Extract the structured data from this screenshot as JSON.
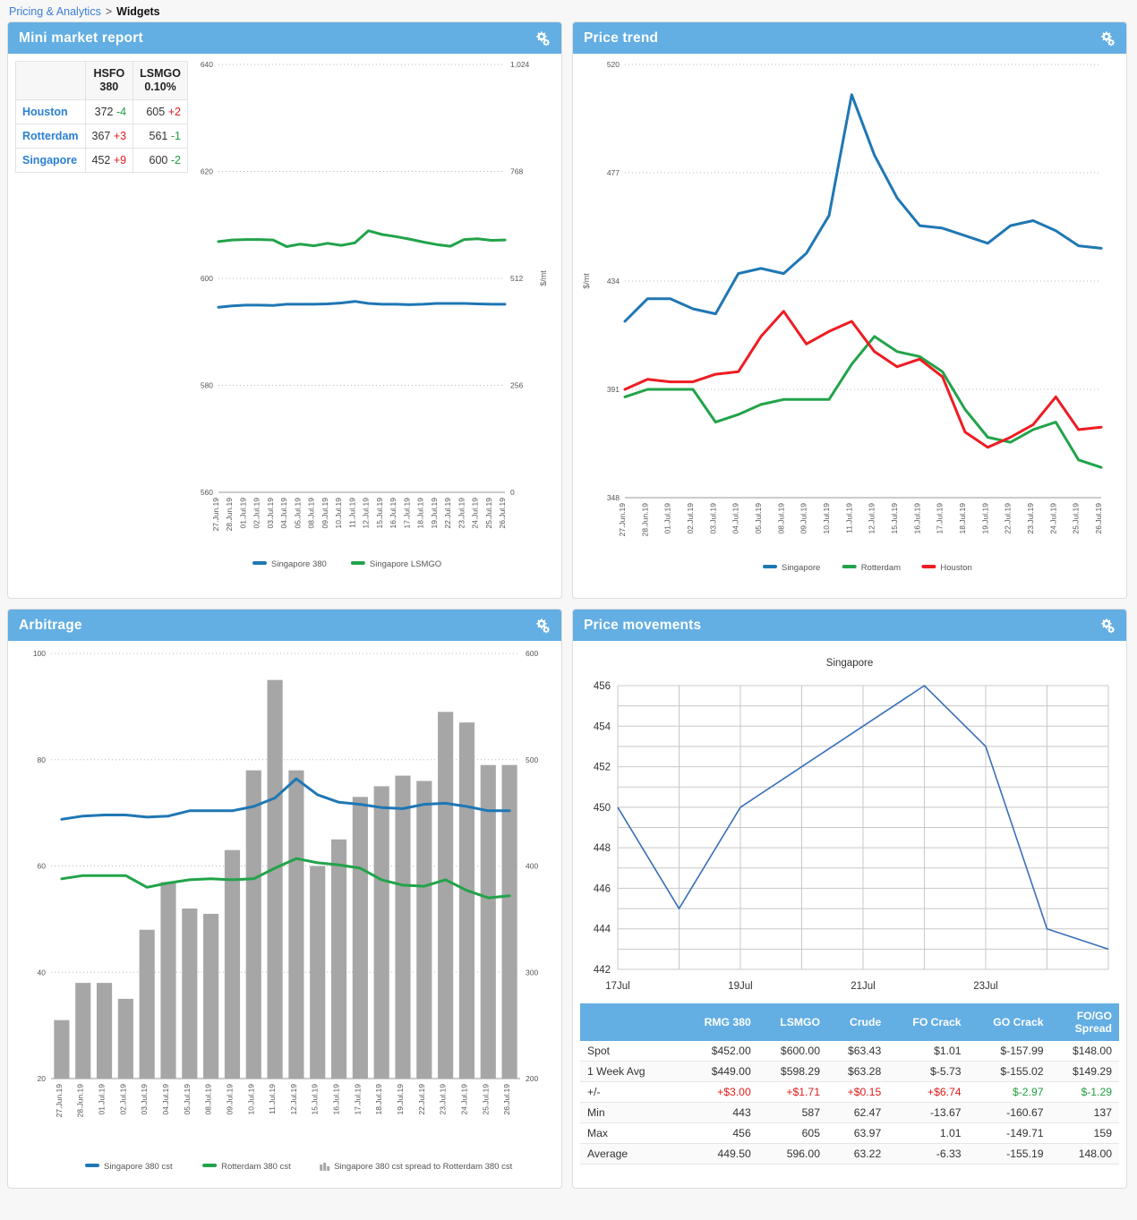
{
  "breadcrumb": {
    "root": "Pricing & Analytics",
    "separator": ">",
    "current": "Widgets"
  },
  "icons": {
    "settings": "cogs-icon"
  },
  "colors": {
    "header": "#63aee3",
    "blue": "#1f77b4",
    "green": "#22a34a",
    "red": "#ee1c23",
    "bar": "#a6a6a6",
    "up": "#e01b1b",
    "down": "#1f9e3f"
  },
  "panels": {
    "mini": {
      "title": "Mini market report"
    },
    "trend": {
      "title": "Price trend"
    },
    "arbitrage": {
      "title": "Arbitrage"
    },
    "movements": {
      "title": "Price movements"
    }
  },
  "mini_table": {
    "columns": [
      "",
      "HSFO 380",
      "LSMGO 0.10%"
    ],
    "col_head_lines": [
      [
        "HSFO",
        "380"
      ],
      [
        "LSMGO",
        "0.10%"
      ]
    ],
    "rows": [
      {
        "location": "Houston",
        "hsfo": "372",
        "hsfo_chg": "-4",
        "hsfo_dir": "down",
        "lsmgo": "605",
        "lsmgo_chg": "+2",
        "lsmgo_dir": "up"
      },
      {
        "location": "Rotterdam",
        "hsfo": "367",
        "hsfo_chg": "+3",
        "hsfo_dir": "up",
        "lsmgo": "561",
        "lsmgo_chg": "-1",
        "lsmgo_dir": "down"
      },
      {
        "location": "Singapore",
        "hsfo": "452",
        "hsfo_chg": "+9",
        "hsfo_dir": "up",
        "lsmgo": "600",
        "lsmgo_chg": "-2",
        "lsmgo_dir": "down"
      }
    ]
  },
  "dates": [
    "27.Jun.19",
    "28.Jun.19",
    "01.Jul.19",
    "02.Jul.19",
    "03.Jul.19",
    "04.Jul.19",
    "05.Jul.19",
    "08.Jul.19",
    "09.Jul.19",
    "10.Jul.19",
    "11.Jul.19",
    "12.Jul.19",
    "15.Jul.19",
    "16.Jul.19",
    "17.Jul.19",
    "18.Jul.19",
    "19.Jul.19",
    "22.Jul.19",
    "23.Jul.19",
    "24.Jul.19",
    "25.Jul.19",
    "26.Jul.19"
  ],
  "chart_data": [
    {
      "id": "mini-market-report",
      "type": "line",
      "title": "Mini market report",
      "ylabel": "$/mt",
      "x": [
        "27.Jun.19",
        "28.Jun.19",
        "01.Jul.19",
        "02.Jul.19",
        "03.Jul.19",
        "04.Jul.19",
        "05.Jul.19",
        "08.Jul.19",
        "09.Jul.19",
        "10.Jul.19",
        "11.Jul.19",
        "12.Jul.19",
        "15.Jul.19",
        "16.Jul.19",
        "17.Jul.19",
        "18.Jul.19",
        "19.Jul.19",
        "22.Jul.19",
        "23.Jul.19",
        "24.Jul.19",
        "25.Jul.19",
        "26.Jul.19"
      ],
      "left_axis": {
        "ticks": [
          560,
          580,
          600,
          620,
          640
        ],
        "min": 560,
        "max": 640
      },
      "right_axis": {
        "ticks": [
          0,
          256,
          512,
          768,
          1024
        ],
        "tick_labels": [
          "0",
          "256",
          "512",
          "768",
          "1,024"
        ],
        "min": 0,
        "max": 1024
      },
      "grid": true,
      "legend_position": "bottom",
      "series": [
        {
          "name": "Singapore 380",
          "color": "#1f77b4",
          "axis": "right",
          "values": [
            443,
            446,
            448,
            448,
            447,
            450,
            450,
            450,
            451,
            453,
            457,
            452,
            450,
            450,
            449,
            450,
            452,
            452,
            452,
            451,
            450,
            450
          ]
        },
        {
          "name": "Singapore LSMGO",
          "color": "#22a34a",
          "axis": "right",
          "values": [
            600,
            604,
            605,
            605,
            604,
            588,
            594,
            590,
            596,
            591,
            597,
            626,
            617,
            612,
            606,
            599,
            593,
            589,
            605,
            607,
            603,
            604
          ]
        }
      ]
    },
    {
      "id": "price-trend",
      "type": "line",
      "title": "Price trend",
      "ylabel": "$/mt",
      "x": [
        "27.Jun.19",
        "28.Jun.19",
        "01.Jul.19",
        "02.Jul.19",
        "03.Jul.19",
        "04.Jul.19",
        "05.Jul.19",
        "08.Jul.19",
        "09.Jul.19",
        "10.Jul.19",
        "11.Jul.19",
        "12.Jul.19",
        "15.Jul.19",
        "16.Jul.19",
        "17.Jul.19",
        "18.Jul.19",
        "19.Jul.19",
        "22.Jul.19",
        "23.Jul.19",
        "24.Jul.19",
        "25.Jul.19",
        "26.Jul.19"
      ],
      "left_axis": {
        "ticks": [
          348,
          391,
          434,
          477,
          520
        ],
        "min": 348,
        "max": 520
      },
      "grid": true,
      "legend_position": "bottom",
      "series": [
        {
          "name": "Singapore",
          "color": "#1f77b4",
          "values": [
            418,
            427,
            427,
            423,
            421,
            437,
            439,
            437,
            445,
            460,
            508,
            484,
            467,
            456,
            455,
            452,
            449,
            456,
            458,
            454,
            448,
            447
          ]
        },
        {
          "name": "Rotterdam",
          "color": "#22a34a",
          "values": [
            388,
            391,
            391,
            391,
            378,
            381,
            385,
            387,
            387,
            387,
            401,
            412,
            406,
            404,
            398,
            383,
            372,
            370,
            375,
            378,
            363,
            360
          ]
        },
        {
          "name": "Houston",
          "color": "#ee1c23",
          "values": [
            391,
            395,
            394,
            394,
            397,
            398,
            412,
            422,
            409,
            414,
            418,
            406,
            400,
            403,
            396,
            374,
            368,
            372,
            377,
            388,
            375,
            376
          ]
        }
      ]
    },
    {
      "id": "arbitrage",
      "type": "line",
      "title": "Arbitrage",
      "x": [
        "27.Jun.19",
        "28.Jun.19",
        "01.Jul.19",
        "02.Jul.19",
        "03.Jul.19",
        "04.Jul.19",
        "05.Jul.19",
        "08.Jul.19",
        "09.Jul.19",
        "10.Jul.19",
        "11.Jul.19",
        "12.Jul.19",
        "15.Jul.19",
        "16.Jul.19",
        "17.Jul.19",
        "18.Jul.19",
        "19.Jul.19",
        "22.Jul.19",
        "23.Jul.19",
        "24.Jul.19",
        "25.Jul.19",
        "26.Jul.19"
      ],
      "left_axis": {
        "ticks": [
          20,
          40,
          60,
          80,
          100
        ],
        "min": 20,
        "max": 100
      },
      "right_axis": {
        "ticks": [
          200,
          300,
          400,
          500,
          600
        ],
        "min": 200,
        "max": 600
      },
      "grid": true,
      "legend_position": "bottom",
      "series": [
        {
          "name": "Singapore 380 cst",
          "color": "#1f77b4",
          "axis": "right",
          "type": "line",
          "values": [
            444,
            447,
            448,
            448,
            446,
            447,
            452,
            452,
            452,
            456,
            464,
            482,
            467,
            460,
            458,
            455,
            454,
            458,
            459,
            456,
            452,
            452
          ]
        },
        {
          "name": "Rotterdam 380 cst",
          "color": "#22a34a",
          "axis": "right",
          "type": "line",
          "values": [
            388,
            391,
            391,
            391,
            380,
            384,
            387,
            388,
            387,
            388,
            398,
            407,
            403,
            401,
            398,
            387,
            382,
            381,
            387,
            377,
            370,
            372
          ]
        },
        {
          "name": "Singapore 380 cst spread to Rotterdam 380 cst",
          "color": "#a6a6a6",
          "axis": "left",
          "type": "bar",
          "values": [
            31,
            38,
            38,
            35,
            48,
            57,
            52,
            51,
            63,
            78,
            95,
            78,
            60,
            65,
            73,
            75,
            77,
            76,
            89,
            87,
            79,
            79
          ]
        }
      ]
    },
    {
      "id": "price-movements",
      "type": "line",
      "title": "Singapore",
      "x_tick_labels": [
        "17Jul",
        "19Jul",
        "21Jul",
        "23Jul"
      ],
      "x_tick_positions": [
        0,
        2,
        4,
        6
      ],
      "y_axis": {
        "ticks": [
          442,
          444,
          446,
          448,
          450,
          452,
          454,
          456
        ],
        "min": 442,
        "max": 456
      },
      "grid": true,
      "legend_position": "none",
      "series": [
        {
          "name": "Singapore",
          "color": "#3a6fb8",
          "x": [
            0,
            1,
            2,
            3,
            4,
            5,
            6,
            7,
            8
          ],
          "values": [
            450,
            445,
            450,
            452,
            454,
            456,
            453,
            444,
            443
          ]
        }
      ]
    }
  ],
  "mini_legend": [
    {
      "label": "Singapore 380",
      "color": "#1f77b4"
    },
    {
      "label": "Singapore LSMGO",
      "color": "#22a34a"
    }
  ],
  "trend_legend": [
    {
      "label": "Singapore",
      "color": "#1f77b4"
    },
    {
      "label": "Rotterdam",
      "color": "#22a34a"
    },
    {
      "label": "Houston",
      "color": "#ee1c23"
    }
  ],
  "arb_legend": [
    {
      "label": "Singapore 380 cst",
      "color": "#1f77b4",
      "shape": "line"
    },
    {
      "label": "Rotterdam 380 cst",
      "color": "#22a34a",
      "shape": "line"
    },
    {
      "label": "Singapore 380 cst spread to Rotterdam 380 cst",
      "color": "#a6a6a6",
      "shape": "bars"
    }
  ],
  "movements_table": {
    "columns": [
      "",
      "RMG 380",
      "LSMGO",
      "Crude",
      "FO Crack",
      "GO Crack",
      "FO/GO Spread"
    ],
    "col_head_lines": [
      [
        "FO/GO",
        "Spread"
      ]
    ],
    "rows": [
      {
        "label": "Spot",
        "cells": [
          "$452.00",
          "$600.00",
          "$63.43",
          "$1.01",
          "$-157.99",
          "$148.00"
        ],
        "signs": [
          "",
          "",
          "",
          "",
          "",
          ""
        ]
      },
      {
        "label": "1 Week Avg",
        "cells": [
          "$449.00",
          "$598.29",
          "$63.28",
          "$-5.73",
          "$-155.02",
          "$149.29"
        ],
        "signs": [
          "",
          "",
          "",
          "",
          "",
          ""
        ]
      },
      {
        "label": "+/-",
        "cells": [
          "+$3.00",
          "+$1.71",
          "+$0.15",
          "+$6.74",
          "$-2.97",
          "$-1.29"
        ],
        "signs": [
          "pos",
          "pos",
          "pos",
          "pos",
          "neg",
          "neg"
        ]
      },
      {
        "label": "Min",
        "cells": [
          "443",
          "587",
          "62.47",
          "-13.67",
          "-160.67",
          "137"
        ],
        "signs": [
          "",
          "",
          "",
          "",
          "",
          ""
        ]
      },
      {
        "label": "Max",
        "cells": [
          "456",
          "605",
          "63.97",
          "1.01",
          "-149.71",
          "159"
        ],
        "signs": [
          "",
          "",
          "",
          "",
          "",
          ""
        ]
      },
      {
        "label": "Average",
        "cells": [
          "449.50",
          "596.00",
          "63.22",
          "-6.33",
          "-155.19",
          "148.00"
        ],
        "signs": [
          "",
          "",
          "",
          "",
          "",
          ""
        ]
      }
    ]
  }
}
